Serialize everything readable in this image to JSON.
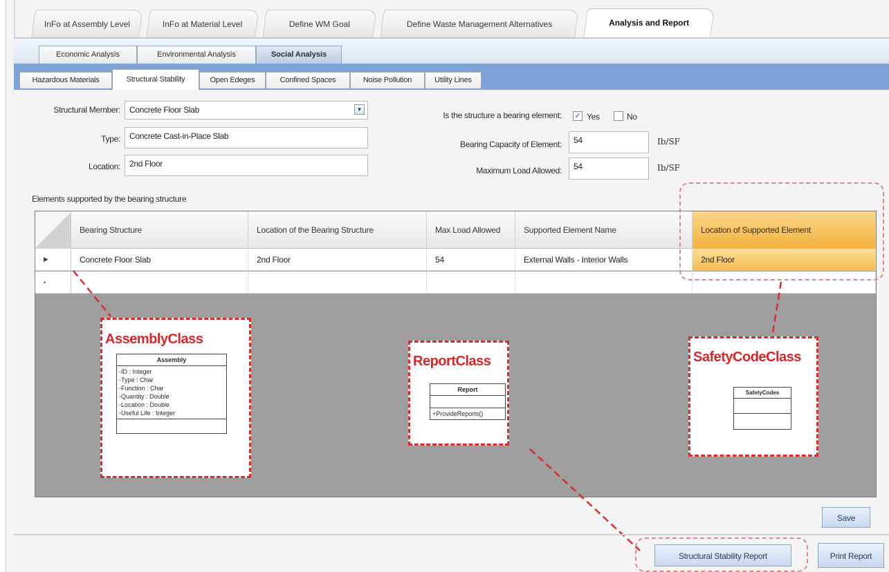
{
  "top_tabs": [
    {
      "label": "InFo at Assembly Level"
    },
    {
      "label": "InFo at Material Level"
    },
    {
      "label": "Define WM Goal"
    },
    {
      "label": "Define Waste Management Alternatives"
    },
    {
      "label": "Analysis and Report"
    }
  ],
  "sub_tabs": [
    {
      "label": "Economic Analysis"
    },
    {
      "label": "Environmental Analysis"
    },
    {
      "label": "Social Analysis"
    }
  ],
  "analysis_tabs": [
    {
      "label": "Hazardous Materials"
    },
    {
      "label": "Structural Stability"
    },
    {
      "label": "Open Edeges"
    },
    {
      "label": "Confined Spaces"
    },
    {
      "label": "Noise Pollution"
    },
    {
      "label": "Utility Lines"
    }
  ],
  "form": {
    "structural_member_label": "Structural Member:",
    "structural_member_value": "Concrete Floor Slab",
    "type_label": "Type:",
    "type_value": "Concrete Cast-in-Place Slab",
    "location_label": "Location:",
    "location_value": "2nd Floor",
    "bearing_question": "Is the structure a bearing element:",
    "yes_label": "Yes",
    "no_label": "No",
    "yes_check": "✓",
    "bearing_capacity_label": "Bearing Capacity of Element:",
    "bearing_capacity_value": "54",
    "bearing_capacity_unit": "Ib/SF",
    "max_load_label": "Maximum Load Allowed:",
    "max_load_value": "54",
    "max_load_unit": "Ib/SF"
  },
  "grid": {
    "caption": "Elements supported by the bearing structure",
    "columns": [
      "Bearing Structure",
      "Location of the Bearing Structure",
      "Max Load Allowed",
      "Supported Element Name",
      "Location of Supported Element"
    ],
    "rows": [
      {
        "marker": "▶",
        "cells": [
          "Concrete Floor Slab",
          "2nd Floor",
          "54",
          "External Walls - Interior Walls",
          "2nd Floor"
        ]
      },
      {
        "marker": "•",
        "cells": [
          "",
          "",
          "",
          "",
          ""
        ]
      }
    ]
  },
  "annotations": {
    "assembly": {
      "title": "AssemblyClass",
      "class_name": "Assembly",
      "attributes": [
        "-ID : Integer",
        "-Type : Char",
        "-Function : Char",
        "-Quantity : Double",
        "-Location : Double",
        "-Useful Life : Integer"
      ]
    },
    "report": {
      "title": "ReportClass",
      "class_name": "Report",
      "methods": [
        "+ProvideReports()"
      ]
    },
    "safety": {
      "title": "SafetyCodeClass",
      "class_name": "SafetyCodes"
    }
  },
  "buttons": {
    "save": "Save",
    "structural_report": "Structural Stability Report",
    "print_report": "Print Report"
  },
  "colors": {
    "accent_blue": "#7fa2d6",
    "selection_orange": "#f2b23d",
    "annotation_red": "#d62e2e"
  }
}
